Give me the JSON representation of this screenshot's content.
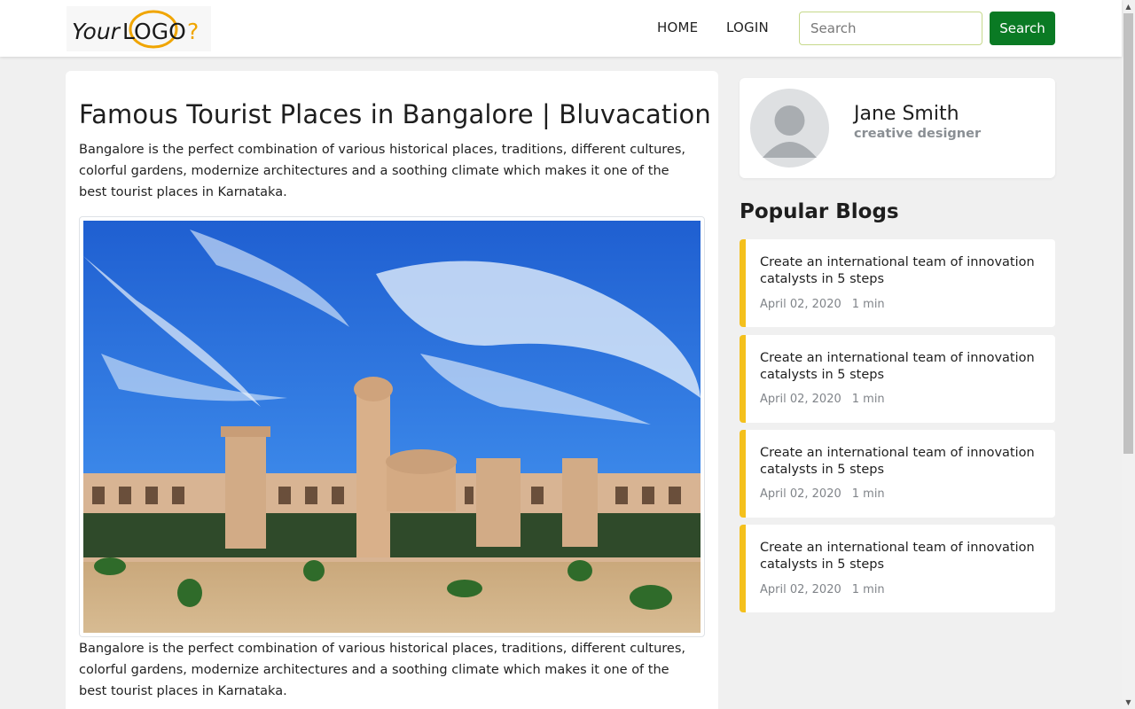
{
  "navbar": {
    "logo_text_your": "Your",
    "logo_text_logo": "LOGO",
    "logo_text_mark": "?",
    "home_label": "HOME",
    "login_label": "LOGIN",
    "search_placeholder": "Search",
    "search_button_label": "Search"
  },
  "article": {
    "title": "Famous Tourist Places in Bangalore | Bluvacation",
    "intro": "Bangalore is the perfect combination of various historical places, traditions, different cultures, colorful gardens, modernize architectures and a soothing climate which makes it one of the best tourist places in Karnataka.",
    "outro": "Bangalore is the perfect combination of various historical places, traditions, different cultures, colorful gardens, modernize architectures and a soothing climate which makes it one of the best tourist places in Karnataka."
  },
  "profile": {
    "name": "Jane Smith",
    "role": "creative designer"
  },
  "popular": {
    "heading": "Popular Blogs",
    "items": [
      {
        "title": "Create an international team of innovation catalysts in 5 steps",
        "date": "April 02, 2020",
        "read_time": "1 min"
      },
      {
        "title": "Create an international team of innovation catalysts in 5 steps",
        "date": "April 02, 2020",
        "read_time": "1 min"
      },
      {
        "title": "Create an international team of innovation catalysts in 5 steps",
        "date": "April 02, 2020",
        "read_time": "1 min"
      },
      {
        "title": "Create an international team of innovation catalysts in 5 steps",
        "date": "April 02, 2020",
        "read_time": "1 min"
      }
    ]
  },
  "colors": {
    "accent_green": "#0a7a24",
    "blog_border": "#f4c01c",
    "logo_orange": "#f0a500"
  },
  "icons": {
    "avatar": "user-avatar-icon",
    "scroll_up": "chevron-up-icon",
    "scroll_down": "chevron-down-icon"
  }
}
